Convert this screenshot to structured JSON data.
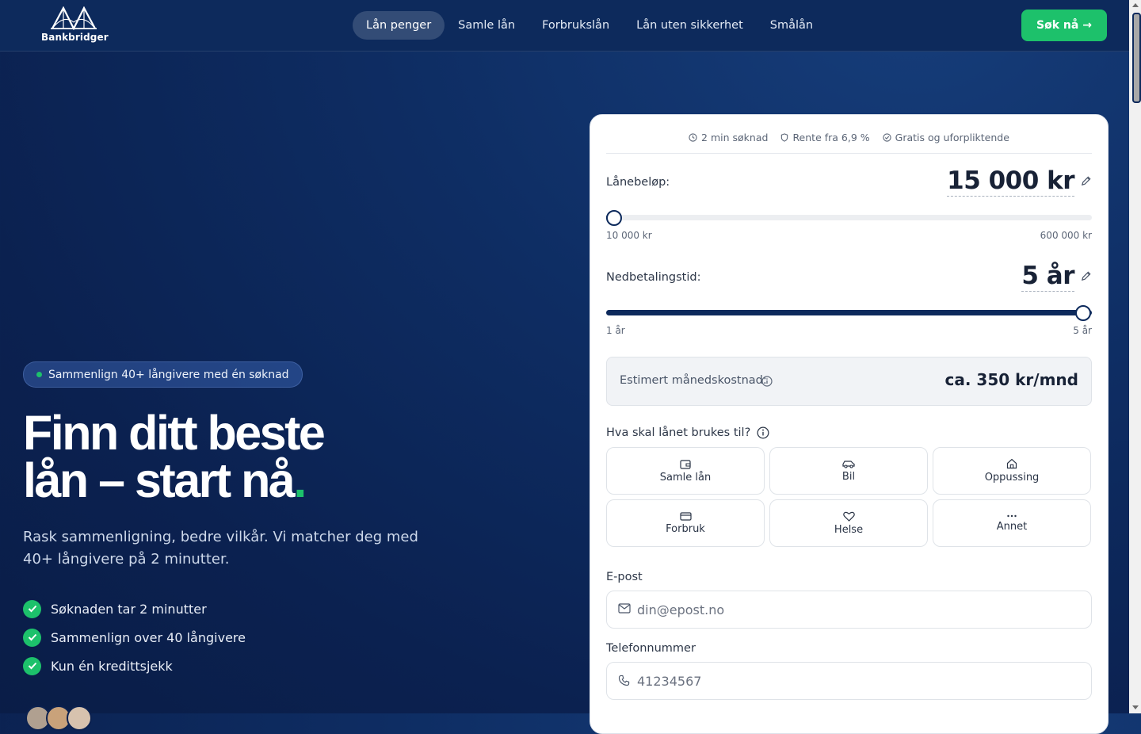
{
  "header": {
    "brand": "Bankbridger",
    "nav": [
      "Lån penger",
      "Samle lån",
      "Forbrukslån",
      "Lån uten sikkerhet",
      "Smålån"
    ],
    "active_nav": "Lån penger",
    "cta": "Søk nå →"
  },
  "hero": {
    "badge": "Sammenlign 40+ långivere med én søknad",
    "title_line1": "Finn ditt beste",
    "title_line2": "lån – start nå",
    "title_dot": ".",
    "subtitle": "Rask sammenligning, bedre vilkår. Vi matcher deg med 40+ långivere på 2 minutter.",
    "checks": [
      "Søknaden tar 2 minutter",
      "Sammenlign over 40 långivere",
      "Kun én kredittsjekk"
    ]
  },
  "form": {
    "features": [
      "2 min søknad",
      "Rente fra 6,9 %",
      "Gratis og uforpliktende"
    ],
    "amount": {
      "label": "Lånebeløp:",
      "value": "15 000 kr",
      "min_label": "10 000 kr",
      "max_label": "600 000 kr",
      "fraction": 0.0085
    },
    "term": {
      "label": "Nedbetalingstid:",
      "value": "5 år",
      "min_label": "1 år",
      "max_label": "5 år",
      "fraction": 1.0
    },
    "estimate": {
      "label": "Estimert månedskostnad:",
      "value": "ca. 350 kr/mnd"
    },
    "purpose_question": "Hva skal lånet brukes til?",
    "purposes": [
      {
        "label": "Samle lån",
        "icon": "wallet-icon"
      },
      {
        "label": "Bil",
        "icon": "car-icon"
      },
      {
        "label": "Oppussing",
        "icon": "house-icon"
      },
      {
        "label": "Forbruk",
        "icon": "credit-card-icon"
      },
      {
        "label": "Helse",
        "icon": "heart-icon"
      },
      {
        "label": "Annet",
        "icon": "more-icon"
      }
    ],
    "email": {
      "label": "E-post",
      "placeholder": "din@epost.no"
    },
    "phone": {
      "label": "Telefonnummer",
      "placeholder": "41234567"
    }
  },
  "colors": {
    "accent_green": "#1dc16b",
    "navy": "#0d2a5c",
    "background": "#0b2150"
  }
}
